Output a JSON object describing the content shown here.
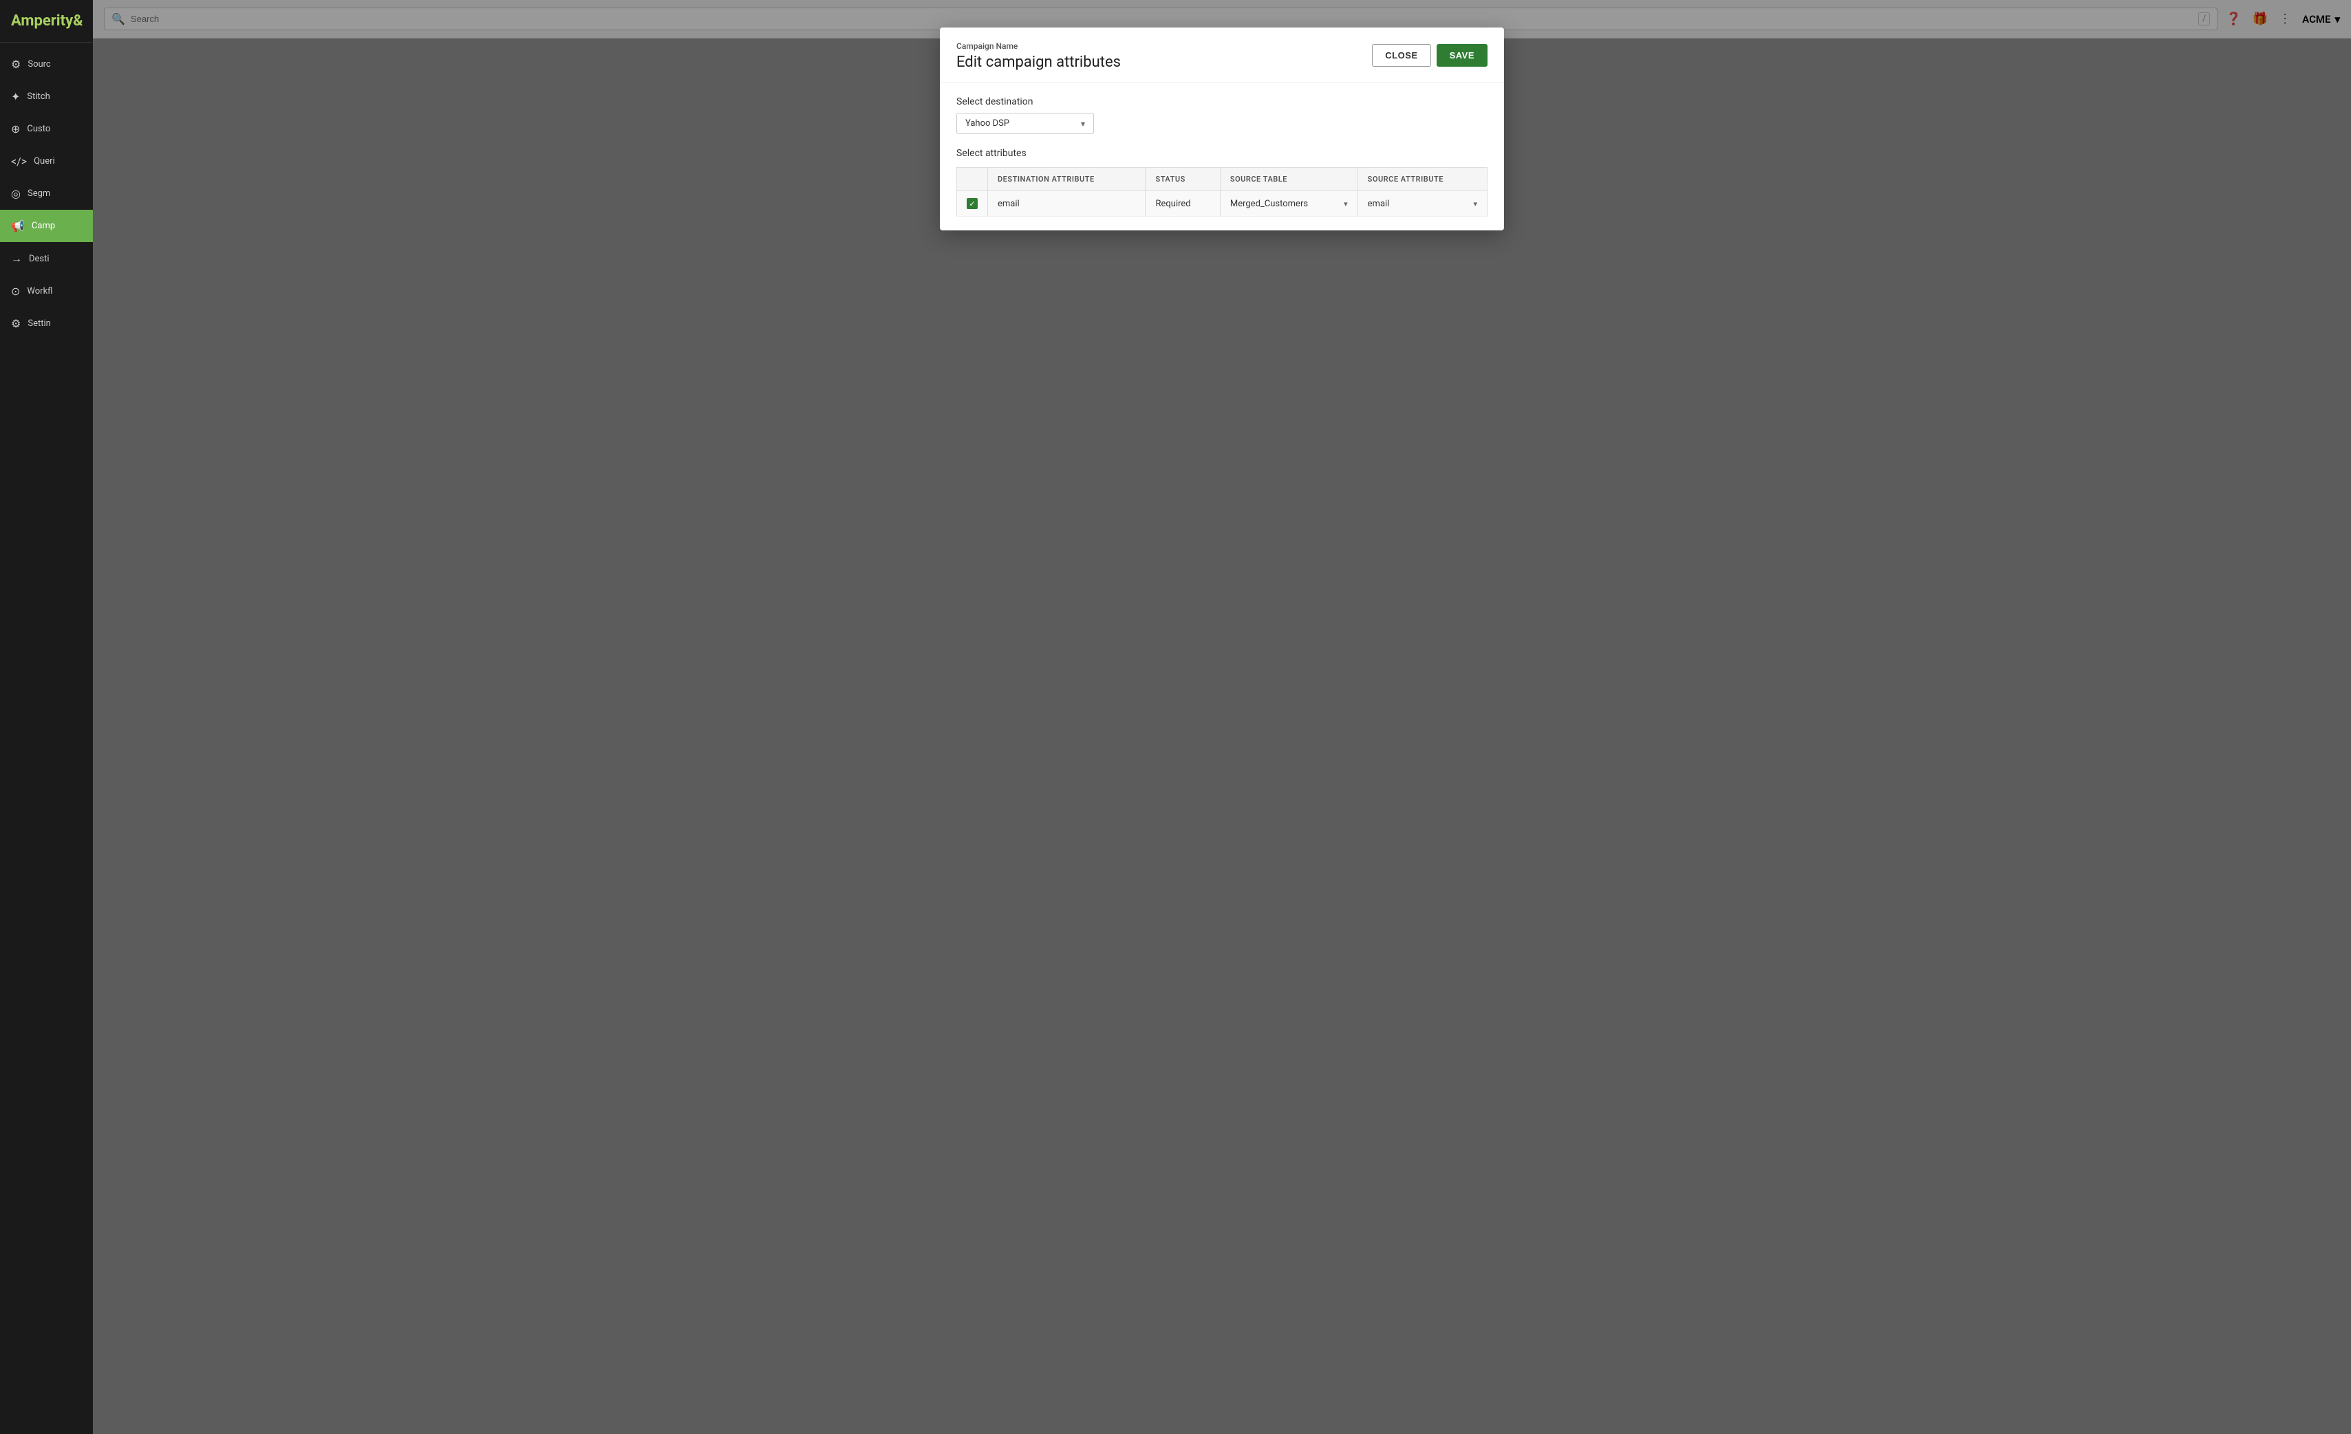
{
  "sidebar": {
    "logo": "Amperity",
    "logo_icon": "&",
    "items": [
      {
        "id": "sources",
        "label": "Sourc",
        "icon": "⚙",
        "active": false
      },
      {
        "id": "stitch",
        "label": "Stitch",
        "icon": "✦",
        "active": false
      },
      {
        "id": "customer",
        "label": "Custo",
        "icon": "⊕",
        "active": false
      },
      {
        "id": "queries",
        "label": "Queri",
        "icon": "</>",
        "active": false
      },
      {
        "id": "segments",
        "label": "Segm",
        "icon": "◎",
        "active": false
      },
      {
        "id": "campaigns",
        "label": "Camp",
        "icon": "📢",
        "active": true
      },
      {
        "id": "destinations",
        "label": "Desti",
        "icon": "→",
        "active": false
      },
      {
        "id": "workflows",
        "label": "Workfl",
        "icon": "⊙",
        "active": false
      },
      {
        "id": "settings",
        "label": "Settin",
        "icon": "⚙",
        "active": false
      }
    ]
  },
  "topbar": {
    "search_placeholder": "Search",
    "slash_hint": "/",
    "account_name": "ACME"
  },
  "modal": {
    "campaign_name_label": "Campaign Name",
    "title": "Edit campaign attributes",
    "close_button": "CLOSE",
    "save_button": "SAVE",
    "destination_label": "Select destination",
    "destination_value": "Yahoo DSP",
    "attributes_label": "Select attributes",
    "table": {
      "columns": [
        {
          "id": "checkbox",
          "label": ""
        },
        {
          "id": "destination_attr",
          "label": "DESTINATION ATTRIBUTE"
        },
        {
          "id": "status",
          "label": "STATUS"
        },
        {
          "id": "source_table",
          "label": "SOURCE TABLE"
        },
        {
          "id": "source_attribute",
          "label": "SOURCE ATTRIBUTE"
        }
      ],
      "rows": [
        {
          "checked": true,
          "destination_attribute": "email",
          "status": "Required",
          "source_table": "Merged_Customers",
          "source_attribute": "email"
        }
      ]
    }
  }
}
